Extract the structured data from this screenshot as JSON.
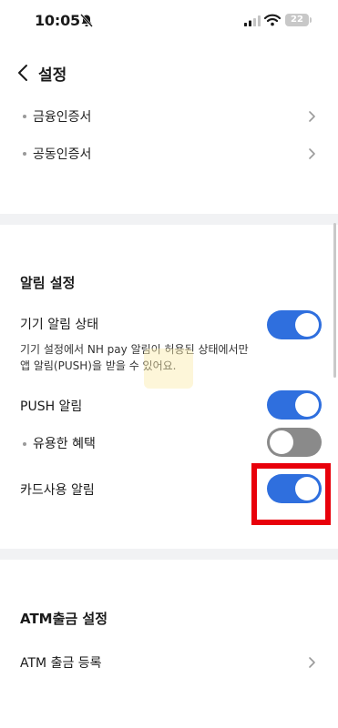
{
  "status_bar": {
    "time": "10:05",
    "battery_level": "22",
    "icons": [
      "bell-slash-icon",
      "cellular-signal-icon",
      "wifi-icon",
      "battery-icon"
    ]
  },
  "header": {
    "back_icon": "chevron-left-icon",
    "title": "설정"
  },
  "certificates": {
    "items": [
      {
        "label": "금융인증서",
        "icon": "chevron-right-icon"
      },
      {
        "label": "공동인증서",
        "icon": "chevron-right-icon"
      }
    ]
  },
  "notification_settings": {
    "title": "알림 설정",
    "device_status": {
      "label": "기기 알림 상태",
      "description_line1": "기기 설정에서 NH pay 알림이 허용된 상태에서만",
      "description_line2": "앱 알림(PUSH)을 받을 수 있어요.",
      "enabled": true
    },
    "push": {
      "label": "PUSH 알림",
      "enabled": true
    },
    "benefits": {
      "label": "유용한 혜택",
      "enabled": false
    },
    "card_usage": {
      "label": "카드사용 알림",
      "enabled": true
    }
  },
  "atm_settings": {
    "title": "ATM출금 설정",
    "register_label": "ATM 출금 등록",
    "icon": "chevron-right-icon"
  },
  "colors": {
    "toggle_on": "#2f6fde",
    "toggle_off": "#8a8a8a",
    "highlight": "#e8000b",
    "section_divider": "#f1f2f4"
  }
}
